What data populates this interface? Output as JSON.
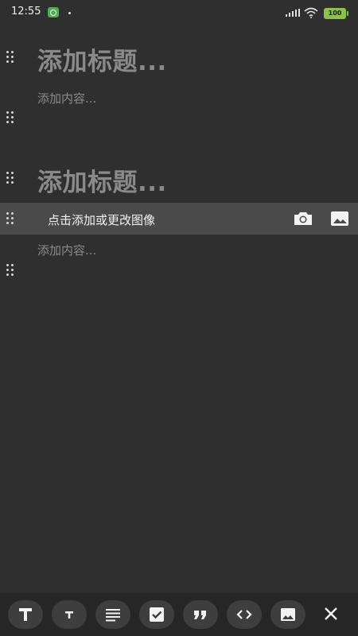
{
  "status_bar": {
    "time": "12:55",
    "battery": "100"
  },
  "editor": {
    "blocks": [
      {
        "type": "title",
        "placeholder": "添加标题..."
      },
      {
        "type": "content",
        "placeholder": "添加内容..."
      },
      {
        "type": "title",
        "placeholder": "添加标题..."
      },
      {
        "type": "image",
        "label": "点击添加或更改图像"
      },
      {
        "type": "content",
        "placeholder": "添加内容..."
      }
    ]
  },
  "toolbar": {
    "items": [
      "large-text-icon",
      "small-text-icon",
      "paragraph-icon",
      "checkbox-icon",
      "quote-icon",
      "code-icon",
      "image-icon",
      "close-icon"
    ]
  },
  "colors": {
    "background": "#2f2f2f",
    "toolbar": "#262626",
    "image_bar": "#4a4a4a",
    "placeholder": "#8a8a8a"
  }
}
